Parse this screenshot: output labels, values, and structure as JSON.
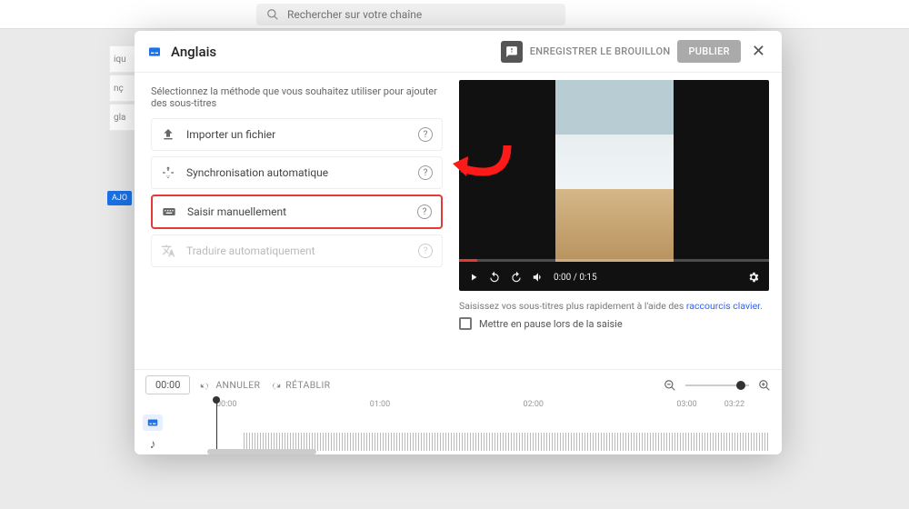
{
  "search": {
    "placeholder": "Rechercher sur votre chaîne"
  },
  "sidebar": {
    "items": [
      "iqu",
      "nç",
      "gla"
    ],
    "chip": "AJO"
  },
  "dialog": {
    "language": "Anglais",
    "save_draft": "ENREGISTRER LE BROUILLON",
    "publish": "PUBLIER",
    "instruction": "Sélectionnez la méthode que vous souhaitez utiliser pour ajouter des sous-titres",
    "options": {
      "import": "Importer un fichier",
      "autosync": "Synchronisation automatique",
      "manual": "Saisir manuellement",
      "translate": "Traduire automatiquement"
    }
  },
  "video": {
    "time": "0:00 / 0:15",
    "tip_prefix": "Saisissez vos sous-titres plus rapidement à l'aide des ",
    "tip_link": "raccourcis clavier",
    "pause_label": "Mettre en pause lors de la saisie"
  },
  "timeline": {
    "timecode": "00:00",
    "undo": "ANNULER",
    "redo": "RÉTABLIR",
    "marks": {
      "m0": "00:00",
      "m1": "01:00",
      "m2": "02:00",
      "m3": "03:00",
      "end": "03:22"
    }
  }
}
